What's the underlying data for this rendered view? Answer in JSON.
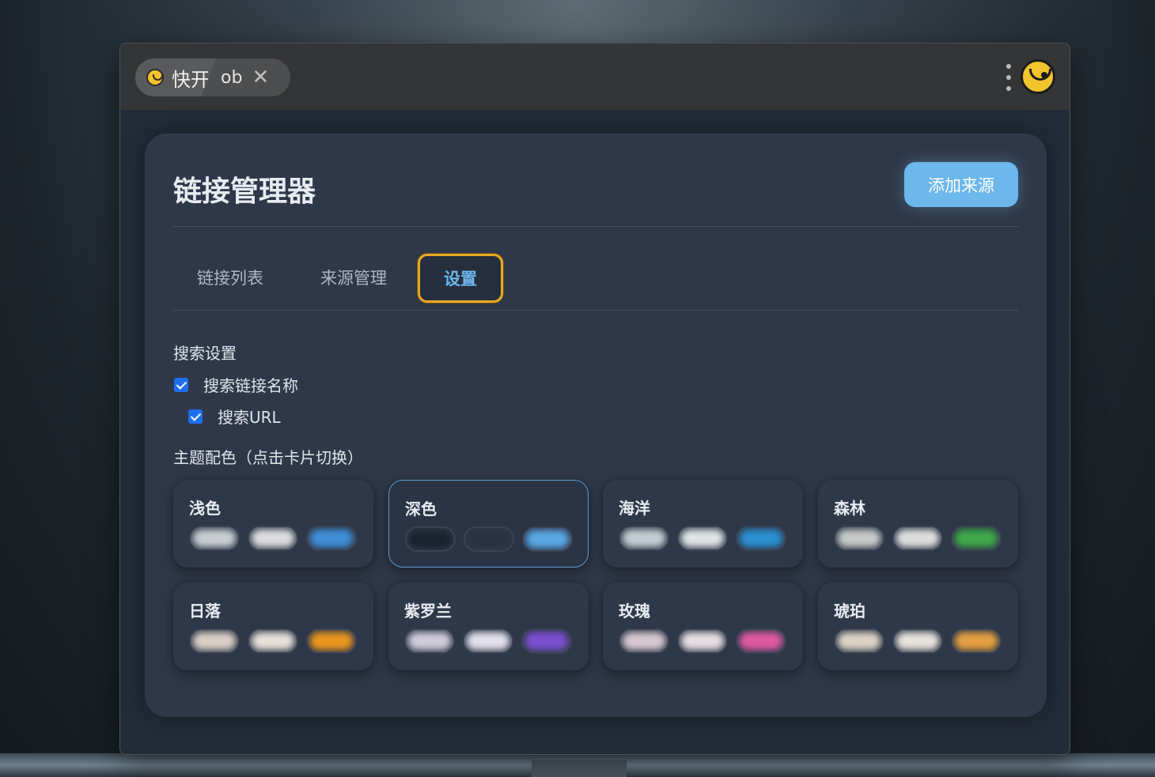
{
  "tabbar": {
    "app_name": "快开",
    "path": "ob",
    "close_symbol": "✕"
  },
  "page": {
    "title": "链接管理器",
    "add_button": "添加来源"
  },
  "tabs": [
    {
      "label": "链接列表",
      "active": false
    },
    {
      "label": "来源管理",
      "active": false
    },
    {
      "label": "设置",
      "active": true
    }
  ],
  "settings": {
    "search_title": "搜索设置",
    "search_name": {
      "label": "搜索链接名称",
      "checked": true
    },
    "search_url": {
      "label": "搜索URL",
      "checked": true
    },
    "theme_title": "主题配色（点击卡片切换）"
  },
  "themes": [
    {
      "name": "浅色",
      "selected": false,
      "colors": [
        "#c9cdd2",
        "#dcdddf",
        "#3f8fd8"
      ]
    },
    {
      "name": "深色",
      "selected": true,
      "colors": [
        "#1b2230",
        "#2a3342",
        "#5aa8e6"
      ]
    },
    {
      "name": "海洋",
      "selected": false,
      "colors": [
        "#c3ccd2",
        "#dfe3e6",
        "#2b8fd0"
      ]
    },
    {
      "name": "森林",
      "selected": false,
      "colors": [
        "#c6c9c6",
        "#dedfdd",
        "#3fa84a"
      ]
    },
    {
      "name": "日落",
      "selected": false,
      "colors": [
        "#d9cfc6",
        "#e6dfd9",
        "#e8961e"
      ]
    },
    {
      "name": "紫罗兰",
      "selected": false,
      "colors": [
        "#cfcbd9",
        "#e2e0ea",
        "#7c4fd0"
      ]
    },
    {
      "name": "玫瑰",
      "selected": false,
      "colors": [
        "#d6c7cf",
        "#e6dde2",
        "#dd5aa3"
      ]
    },
    {
      "name": "琥珀",
      "selected": false,
      "colors": [
        "#dcd3c4",
        "#e7e3dc",
        "#e5a042"
      ]
    }
  ]
}
